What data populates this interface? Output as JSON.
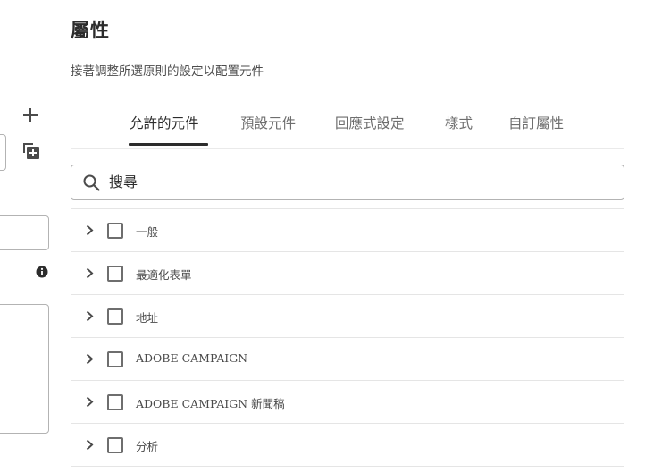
{
  "header": {
    "title": "屬性",
    "description": "接著調整所選原則的設定以配置元件"
  },
  "tabs": [
    {
      "label": "允許的元件",
      "active": true
    },
    {
      "label": "預設元件",
      "active": false
    },
    {
      "label": "回應式設定",
      "active": false
    },
    {
      "label": "樣式",
      "active": false
    },
    {
      "label": "自訂屬性",
      "active": false
    }
  ],
  "search": {
    "placeholder": "搜尋",
    "value": ""
  },
  "components": [
    {
      "label": "一般",
      "checked": false
    },
    {
      "label": "最適化表單",
      "checked": false
    },
    {
      "label": "地址",
      "checked": false
    },
    {
      "label": "ADOBE CAMPAIGN",
      "checked": false
    },
    {
      "label": "ADOBE CAMPAIGN 新聞稿",
      "checked": false
    },
    {
      "label": "分析",
      "checked": false
    }
  ],
  "icons": {
    "add": "plus-icon",
    "duplicate": "copy-icon",
    "info": "info-icon",
    "search": "search-icon",
    "expand": "chevron-right-icon"
  },
  "colors": {
    "text_primary": "#2c2c2c",
    "text_secondary": "#6e6e6e",
    "border": "#b3b3b3",
    "divider": "#e5e5e5"
  }
}
